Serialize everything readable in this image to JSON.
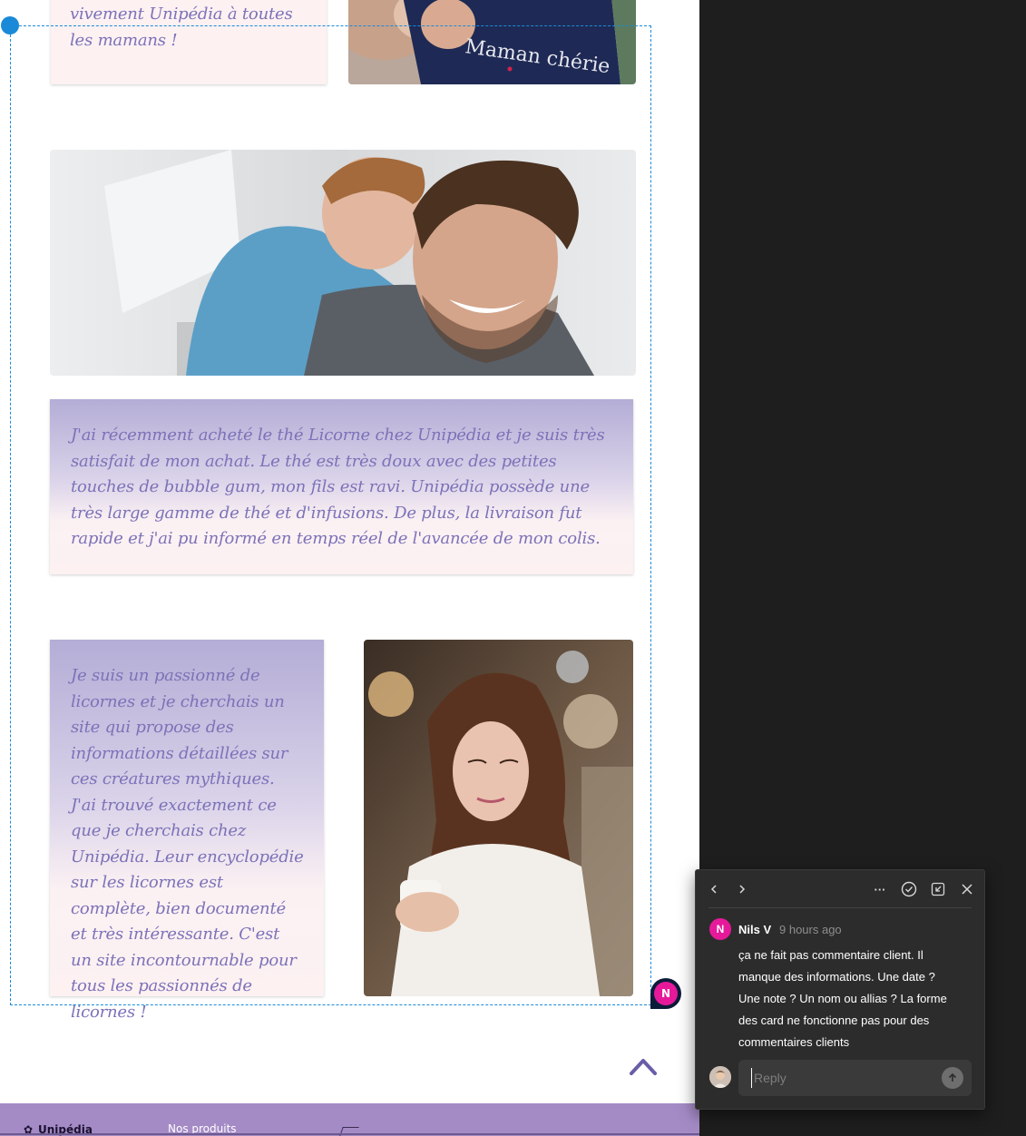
{
  "testimonials": {
    "top_card_text": "vivement Unipédia à toutes les mamans !",
    "top_photo_caption": "Maman chérie",
    "wide_card_text": "J'ai récemment acheté le thé Licorne chez Unipédia et je  suis très satisfait de mon achat. Le thé est très doux avec des petites touches de bubble gum, mon fils est ravi. Unipédia possède une très large gamme de thé et d'infusions. De plus, la livraison fut rapide et j'ai pu informé en temps réel de l'avancée de mon colis.",
    "narrow_card_text": "Je suis un passionné de licornes et je cherchais un site qui  propose des informations détaillées sur ces créatures mythiques. J'ai  trouvé exactement ce que je cherchais chez Unipédia. Leur encyclopédie sur les licornes est complète, bien documenté et très  intéressante. C'est un site incontournable pour tous les  passionnés de licornes !"
  },
  "footer": {
    "brand": "Unipédia",
    "link": "Nos produits"
  },
  "comment_pin": {
    "initial": "N"
  },
  "comment_thread": {
    "author_initial": "N",
    "author": "Nils V",
    "time": "9 hours ago",
    "body": "ça ne fait pas commentaire client. Il manque des informations. Une date ? Une note ? Un nom ou allias ? La forme des card ne fonctionne pas pour des commentaires clients",
    "reply_placeholder": "Reply",
    "more_label": "···"
  },
  "colors": {
    "selection": "#1a8ad8",
    "avatar": "#e6199a",
    "card_text": "#7c72b8",
    "footer": "#a58bc6"
  }
}
